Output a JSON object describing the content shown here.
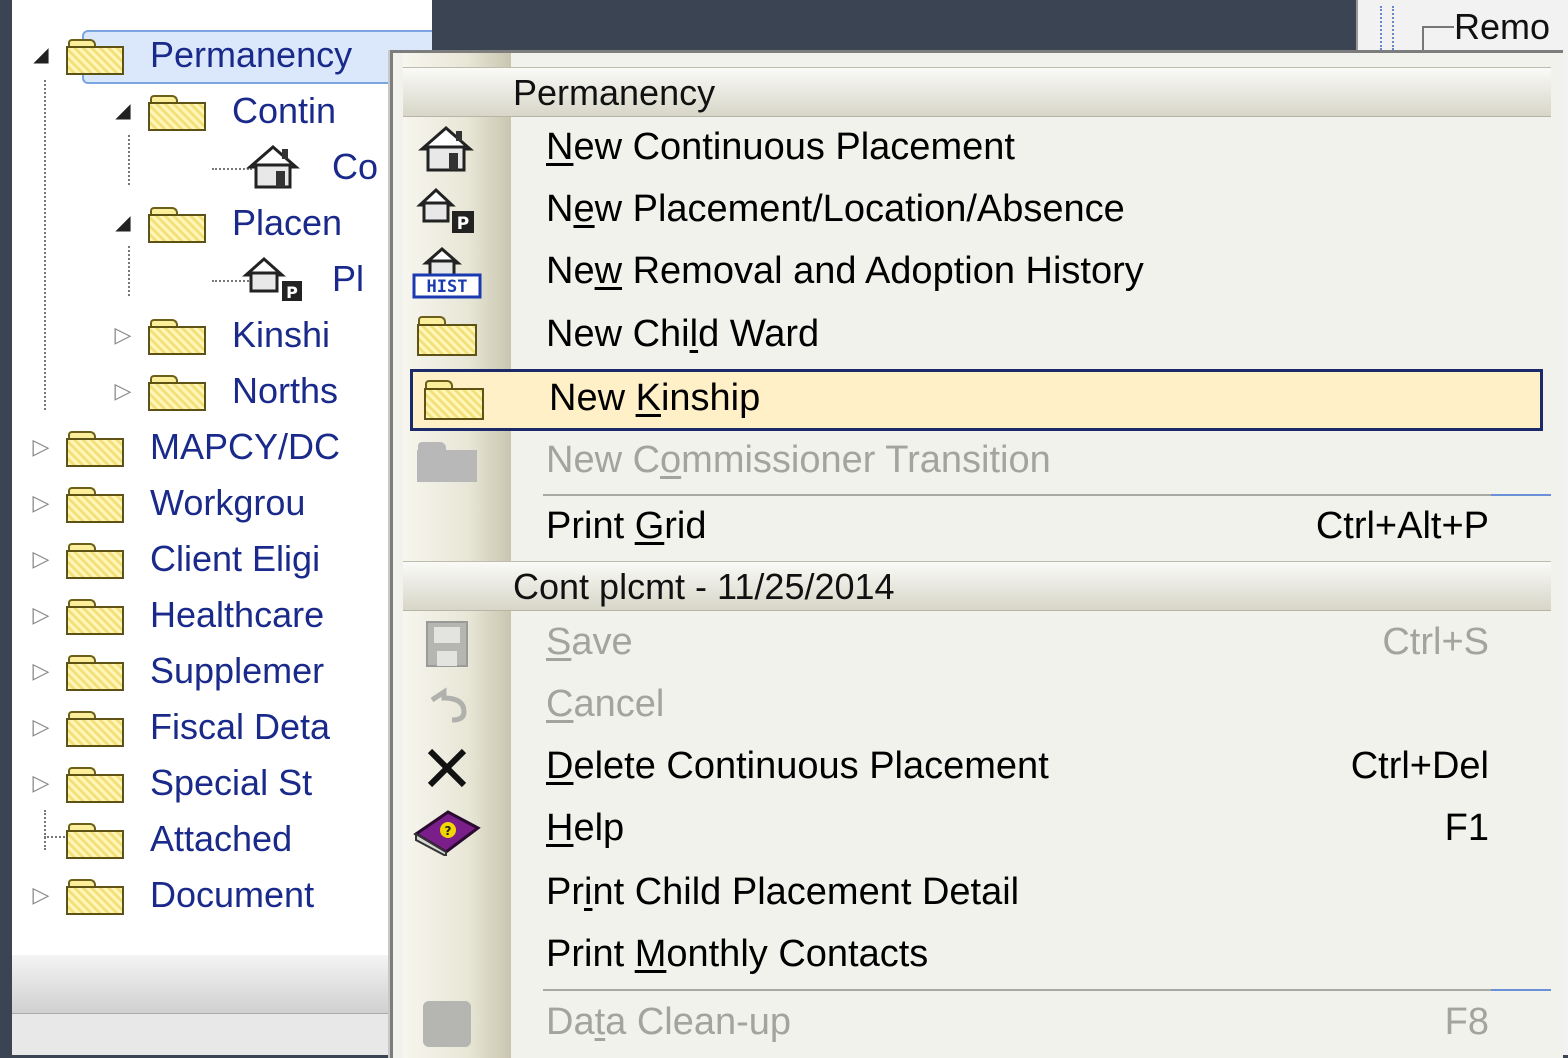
{
  "tree": {
    "items": [
      {
        "label": "Permanency",
        "expander": "open",
        "selected": true
      },
      {
        "label": "Contin",
        "expander": "open"
      },
      {
        "label": "Co",
        "expander": "none"
      },
      {
        "label": "Placen",
        "expander": "open"
      },
      {
        "label": "Pl",
        "expander": "none"
      },
      {
        "label": "Kinshi",
        "expander": "closed"
      },
      {
        "label": "Norths",
        "expander": "closed"
      },
      {
        "label": "MAPCY/DC",
        "expander": "closed"
      },
      {
        "label": "Workgrou",
        "expander": "closed"
      },
      {
        "label": "Client Eligi",
        "expander": "closed"
      },
      {
        "label": "Healthcare",
        "expander": "closed"
      },
      {
        "label": "Supplemer",
        "expander": "closed"
      },
      {
        "label": "Fiscal Deta",
        "expander": "closed"
      },
      {
        "label": "Special St",
        "expander": "closed"
      },
      {
        "label": "Attached",
        "expander": "none"
      },
      {
        "label": "Document",
        "expander": "closed"
      }
    ]
  },
  "right_pane": {
    "group_label": "Remo"
  },
  "menu": {
    "section1_header": "Permanency",
    "section2_header": "Cont plcmt - 11/25/2014",
    "items": {
      "new_continuous_placement": {
        "pre": "",
        "key": "N",
        "post": "ew Continuous Placement",
        "icon": "house-icon"
      },
      "new_placement_location_absence": {
        "pre": "N",
        "key": "e",
        "post": "w Placement/Location/Absence",
        "icon": "house-p-icon"
      },
      "new_removal_adoption_history": {
        "pre": "Ne",
        "key": "w",
        "post": " Removal and Adoption History",
        "icon": "house-hist-icon"
      },
      "new_child_ward": {
        "pre": "New Chi",
        "key": "l",
        "post": "d Ward",
        "icon": "folder-icon"
      },
      "new_kinship": {
        "pre": "New ",
        "key": "K",
        "post": "inship",
        "icon": "folder-icon"
      },
      "new_commissioner_transition": {
        "pre": "New C",
        "key": "o",
        "post": "mmissioner Transition",
        "icon": "folder-icon"
      },
      "print_grid": {
        "pre": "Print ",
        "key": "G",
        "post": "rid",
        "shortcut": "Ctrl+Alt+P"
      },
      "save": {
        "pre": "",
        "key": "S",
        "post": "ave",
        "shortcut": "Ctrl+S",
        "icon": "save-icon"
      },
      "cancel": {
        "pre": "",
        "key": "C",
        "post": "ancel",
        "icon": "undo-icon"
      },
      "delete_continuous_placement": {
        "pre": "",
        "key": "D",
        "post": "elete Continuous Placement",
        "shortcut": "Ctrl+Del",
        "icon": "delete-x-icon"
      },
      "help": {
        "pre": "",
        "key": "H",
        "post": "elp",
        "shortcut": "F1",
        "icon": "help-book-icon"
      },
      "print_child_placement_detail": {
        "pre": "Pr",
        "key": "i",
        "post": "nt Child Placement Detail"
      },
      "print_monthly_contacts": {
        "pre": "Print ",
        "key": "M",
        "post": "onthly Contacts"
      },
      "data_cleanup": {
        "pre": "Da",
        "key": "t",
        "post": "a Clean-up",
        "shortcut": "F8"
      }
    }
  },
  "colors": {
    "menu_highlight": "#fff0c8",
    "highlight_border": "#1c2a6b",
    "tree_text": "#1a2a8a",
    "disabled_text": "#a3a3a0"
  }
}
